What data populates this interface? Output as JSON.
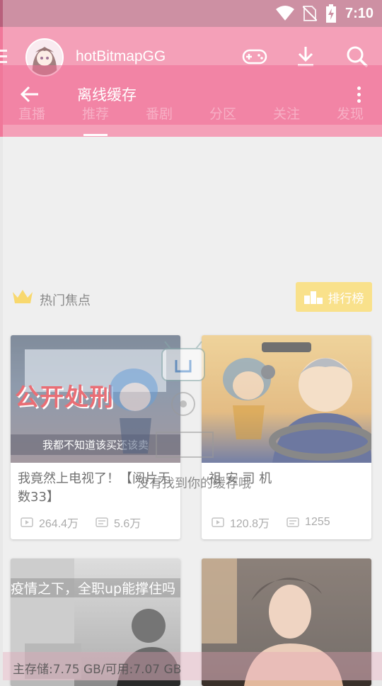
{
  "status_bar": {
    "time": "7:10",
    "icons": [
      "wifi-icon",
      "no-sim-icon",
      "battery-charging-icon"
    ]
  },
  "header": {
    "username": "hotBitmapGG",
    "icons": [
      "menu-icon",
      "gamepad-icon",
      "download-icon",
      "search-icon"
    ]
  },
  "tabs": [
    {
      "label": "直播",
      "active": false
    },
    {
      "label": "推荐",
      "active": true
    },
    {
      "label": "番剧",
      "active": false
    },
    {
      "label": "分区",
      "active": false
    },
    {
      "label": "关注",
      "active": false
    },
    {
      "label": "发现",
      "active": false
    }
  ],
  "section": {
    "title": "热门焦点",
    "rank_button": "排行榜"
  },
  "cards": [
    {
      "thumb_overlay_big": "公开处刑",
      "thumb_overlay_caption": "我都不知道该买还该卖",
      "title": "我竟然上电视了！【阅片无数33】",
      "plays": "264.4万",
      "danmaku": "5.6万"
    },
    {
      "title": "祖 安 司 机",
      "plays": "120.8万",
      "danmaku": "1255"
    },
    {
      "thumb_overlay_caption": "疫情之下，全职up能撑住吗"
    },
    {}
  ],
  "offline_screen": {
    "title": "离线缓存",
    "empty_message": "没有找到你的缓存哦",
    "storage": "主存储:7.75 GB/可用:7.07 GB"
  },
  "colors": {
    "primary_pink": "#f0789a",
    "status_bar": "#b8607c",
    "rank_yellow": "#f7d45a"
  }
}
